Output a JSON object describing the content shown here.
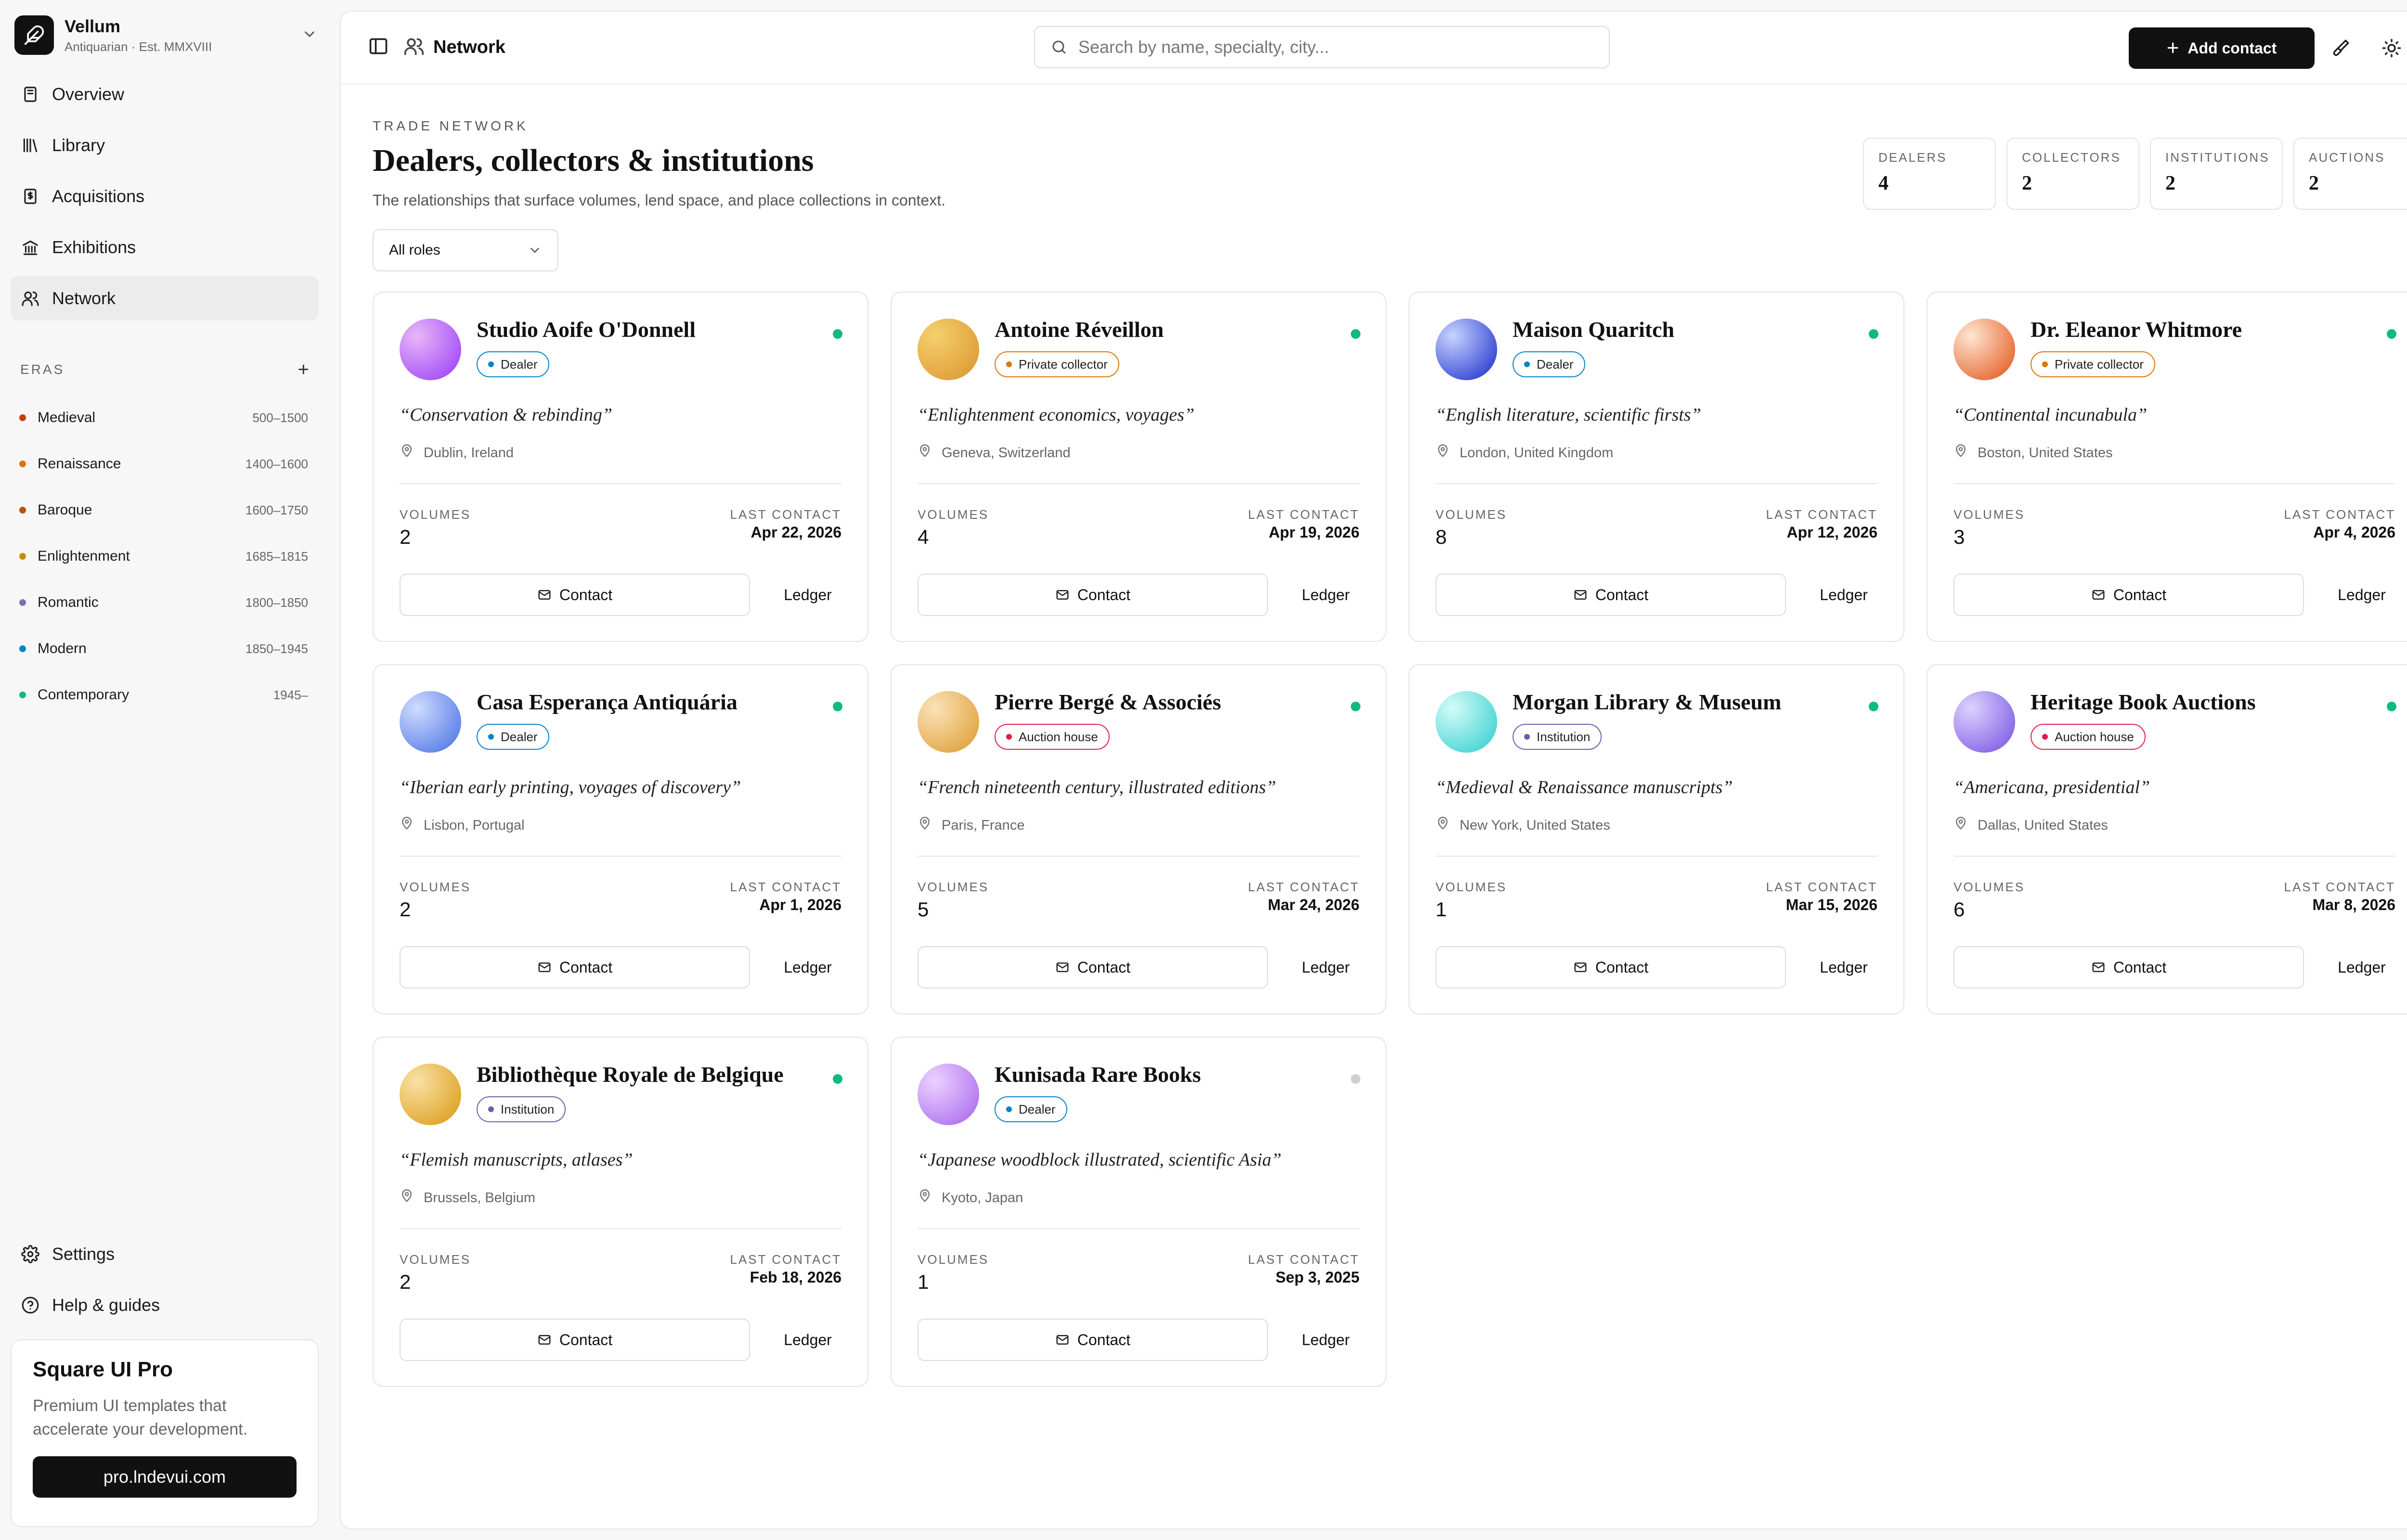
{
  "brand": {
    "name": "Vellum",
    "subtitle": "Antiquarian · Est. MMXVIII"
  },
  "nav": [
    {
      "label": "Overview",
      "icon": "book-icon"
    },
    {
      "label": "Library",
      "icon": "library-icon"
    },
    {
      "label": "Acquisitions",
      "icon": "receipt-icon"
    },
    {
      "label": "Exhibitions",
      "icon": "landmark-icon"
    },
    {
      "label": "Network",
      "icon": "users-icon",
      "active": true
    }
  ],
  "eras": {
    "title": "ERAS",
    "items": [
      {
        "label": "Medieval",
        "range": "500–1500",
        "color": "#c2410c"
      },
      {
        "label": "Renaissance",
        "range": "1400–1600",
        "color": "#d97706"
      },
      {
        "label": "Baroque",
        "range": "1600–1750",
        "color": "#b45309"
      },
      {
        "label": "Enlightenment",
        "range": "1685–1815",
        "color": "#ca8a04"
      },
      {
        "label": "Romantic",
        "range": "1800–1850",
        "color": "#7c6fb0"
      },
      {
        "label": "Modern",
        "range": "1850–1945",
        "color": "#0284c7"
      },
      {
        "label": "Contemporary",
        "range": "1945–",
        "color": "#10b981"
      }
    ]
  },
  "bottom_nav": [
    {
      "label": "Settings",
      "icon": "gear-icon"
    },
    {
      "label": "Help & guides",
      "icon": "help-icon"
    }
  ],
  "pro": {
    "title": "Square UI Pro",
    "desc_line1": "Premium UI templates that",
    "desc_line2": "accelerate your development.",
    "button": "pro.lndevui.com"
  },
  "topbar": {
    "title": "Network",
    "search_placeholder": "Search by name, specialty, city...",
    "add_label": "Add contact"
  },
  "header": {
    "eyebrow": "TRADE NETWORK",
    "title": "Dealers, collectors & institutions",
    "description": "The relationships that surface volumes, lend space, and place collections in context.",
    "filter": "All roles"
  },
  "stats": [
    {
      "label": "DEALERS",
      "value": "4"
    },
    {
      "label": "COLLECTORS",
      "value": "2"
    },
    {
      "label": "INSTITUTIONS",
      "value": "2"
    },
    {
      "label": "AUCTIONS",
      "value": "2"
    }
  ],
  "card_labels": {
    "volumes": "VOLUMES",
    "last_contact": "LAST CONTACT",
    "contact": "Contact",
    "ledger": "Ledger"
  },
  "roles": {
    "dealer": {
      "label": "Dealer",
      "color": "#0284c7"
    },
    "collector": {
      "label": "Private collector",
      "color": "#d97706"
    },
    "institution": {
      "label": "Institution",
      "color": "#6b5fa8"
    },
    "auction": {
      "label": "Auction house",
      "color": "#e11d48"
    }
  },
  "contacts": [
    {
      "name": "Studio Aoife O'Donnell",
      "role": "dealer",
      "specialty": "“Conservation & rebinding”",
      "location": "Dublin, Ireland",
      "volumes": "2",
      "last_contact": "Apr 22, 2026",
      "active": true,
      "avatar": [
        "#e9b6f7",
        "#a855f7"
      ]
    },
    {
      "name": "Antoine Réveillon",
      "role": "collector",
      "specialty": "“Enlightenment economics, voyages”",
      "location": "Geneva, Switzerland",
      "volumes": "4",
      "last_contact": "Apr 19, 2026",
      "active": true,
      "avatar": [
        "#f5cf6e",
        "#e0a13a"
      ]
    },
    {
      "name": "Maison Quaritch",
      "role": "dealer",
      "specialty": "“English literature, scientific firsts”",
      "location": "London, United Kingdom",
      "volumes": "8",
      "last_contact": "Apr 12, 2026",
      "active": true,
      "avatar": [
        "#c8d3ff",
        "#3b4ed6"
      ]
    },
    {
      "name": "Dr. Eleanor Whitmore",
      "role": "collector",
      "specialty": "“Continental incunabula”",
      "location": "Boston, United States",
      "volumes": "3",
      "last_contact": "Apr 4, 2026",
      "active": true,
      "avatar": [
        "#fde6d2",
        "#e8703c"
      ]
    },
    {
      "name": "Casa Esperança Antiquária",
      "role": "dealer",
      "specialty": "“Iberian early printing, voyages of discovery”",
      "location": "Lisbon, Portugal",
      "volumes": "2",
      "last_contact": "Apr 1, 2026",
      "active": true,
      "avatar": [
        "#cfdcff",
        "#6286e8"
      ]
    },
    {
      "name": "Pierre Bergé & Associés",
      "role": "auction",
      "specialty": "“French nineteenth century, illustrated editions”",
      "location": "Paris, France",
      "volumes": "5",
      "last_contact": "Mar 24, 2026",
      "active": true,
      "avatar": [
        "#fbe3b8",
        "#e3a94a"
      ]
    },
    {
      "name": "Morgan Library & Museum",
      "role": "institution",
      "specialty": "“Medieval & Renaissance manuscripts”",
      "location": "New York, United States",
      "volumes": "1",
      "last_contact": "Mar 15, 2026",
      "active": true,
      "avatar": [
        "#d4fbf8",
        "#4fd8d6"
      ]
    },
    {
      "name": "Heritage Book Auctions",
      "role": "auction",
      "specialty": "“Americana, presidential”",
      "location": "Dallas, United States",
      "volumes": "6",
      "last_contact": "Mar 8, 2026",
      "active": true,
      "avatar": [
        "#ddd2ff",
        "#8a6be8"
      ]
    },
    {
      "name": "Bibliothèque Royale de Belgique",
      "role": "institution",
      "specialty": "“Flemish manuscripts, atlases”",
      "location": "Brussels, Belgium",
      "volumes": "2",
      "last_contact": "Feb 18, 2026",
      "active": true,
      "avatar": [
        "#fbe1a6",
        "#e0a830"
      ]
    },
    {
      "name": "Kunisada Rare Books",
      "role": "dealer",
      "specialty": "“Japanese woodblock illustrated, scientific Asia”",
      "location": "Kyoto, Japan",
      "volumes": "1",
      "last_contact": "Sep 3, 2025",
      "active": false,
      "avatar": [
        "#ecd2ff",
        "#b57af0"
      ]
    }
  ],
  "colors": {
    "active_dot": "#10b981",
    "inactive_dot": "#cfcfcf"
  }
}
